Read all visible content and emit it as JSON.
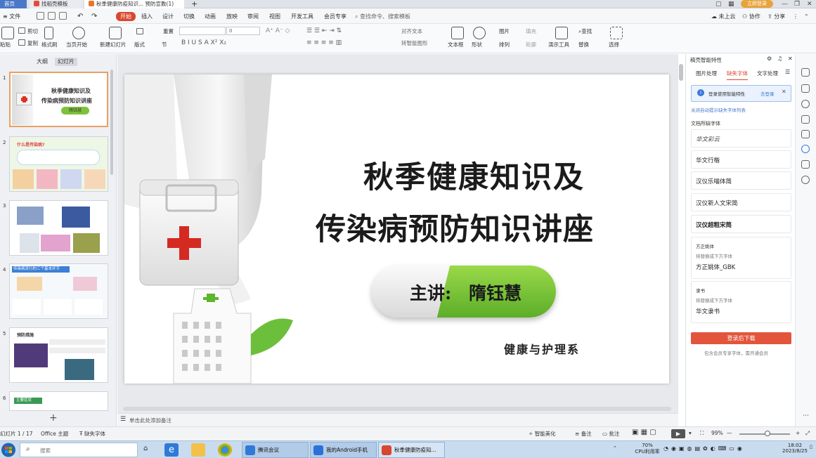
{
  "tabs": {
    "home": "首页",
    "template": "找稻壳模板",
    "doc": "秋季健康防疫知识... 预防宣教(1)"
  },
  "window": {
    "login": "立即登录"
  },
  "menu": {
    "file": "文件",
    "items": [
      "开始",
      "插入",
      "设计",
      "切换",
      "动画",
      "放映",
      "审阅",
      "视图",
      "开发工具",
      "会员专享"
    ],
    "search": "查找命令、搜索模板",
    "right": [
      "未上云",
      "协作",
      "分享"
    ]
  },
  "ribbon": {
    "paste": "粘贴",
    "cut": "剪切",
    "copy": "复制",
    "format_painter": "格式刷",
    "play": "当页开始",
    "new_slide": "新建幻灯片",
    "layout": "版式",
    "section": "节",
    "reset": "重置",
    "font_size": "0",
    "text_box": "文本框",
    "shape": "形状",
    "arrange": "排列",
    "outline": "轮廓",
    "picture": "图片",
    "fill": "填充",
    "presenter": "演示工具",
    "find": "查找",
    "replace": "替换",
    "select": "选择",
    "align_text": "对齐文本",
    "smartart": "转智能图形"
  },
  "left_panel": {
    "tab_outline": "大纲",
    "tab_slides": "幻灯片",
    "slide_numbers": [
      "1",
      "2",
      "3",
      "4",
      "5",
      "6"
    ],
    "thumb1_title1": "秋季健康知识及",
    "thumb1_title2": "传染病预防知识讲座",
    "thumb1_speaker": "隋钰慧",
    "thumb2_heading": "什么是传染病?",
    "thumb4_heading": "传染病流行的三个基本环节",
    "thumb5_heading": "预防措施",
    "thumb6_heading": "主要症状"
  },
  "slide": {
    "title_line1": "秋季健康知识及",
    "title_line2": "传染病预防知识讲座",
    "speaker_label": "主讲:",
    "speaker_name": "隋钰慧",
    "department": "健康与护理系"
  },
  "notes": {
    "placeholder": "单击此处添加备注"
  },
  "right_panel": {
    "title": "稿壳智能特性",
    "tabs": [
      "图片处理",
      "缺失字体",
      "文字处理"
    ],
    "info_text": "登录使用智能特性",
    "info_link": "去登录",
    "auto_link": "关闭自动提示缺失字体列表",
    "section_label": "文档所缺字体",
    "fonts": [
      "华文彩云",
      "华文行楷",
      "汉仪乐喵体简",
      "汉仪新人文宋简",
      "汉仪超粗宋简"
    ],
    "card1_title": "方正姚体",
    "card1_hint": "将替换成下方字体",
    "card1_font": "方正姚体_GBK",
    "card2_title": "隶书",
    "card2_hint": "将替换成下方字体",
    "card2_font": "华文隶书",
    "download_btn": "登录后下载",
    "footer": "包含会员专享字体，需开通会员"
  },
  "status_bar": {
    "slide_count": "幻灯片 1 / 17",
    "theme": "Office 主题",
    "missing_font": "缺失字体",
    "smart_beautify": "智能美化",
    "notes": "备注",
    "comments": "批注",
    "zoom": "99%"
  },
  "taskbar": {
    "search": "搜索",
    "apps": [
      "腾讯会议",
      "我的Android手机",
      "秋季健康防疫知..."
    ],
    "cpu_percent": "70%",
    "cpu_label": "CPU利用率",
    "time": "18:02",
    "date": "2023/8/25"
  },
  "colors": {
    "accent": "#d9472e",
    "pill_green": "#6cbd2f",
    "thumb_selected": "#e8a064"
  }
}
